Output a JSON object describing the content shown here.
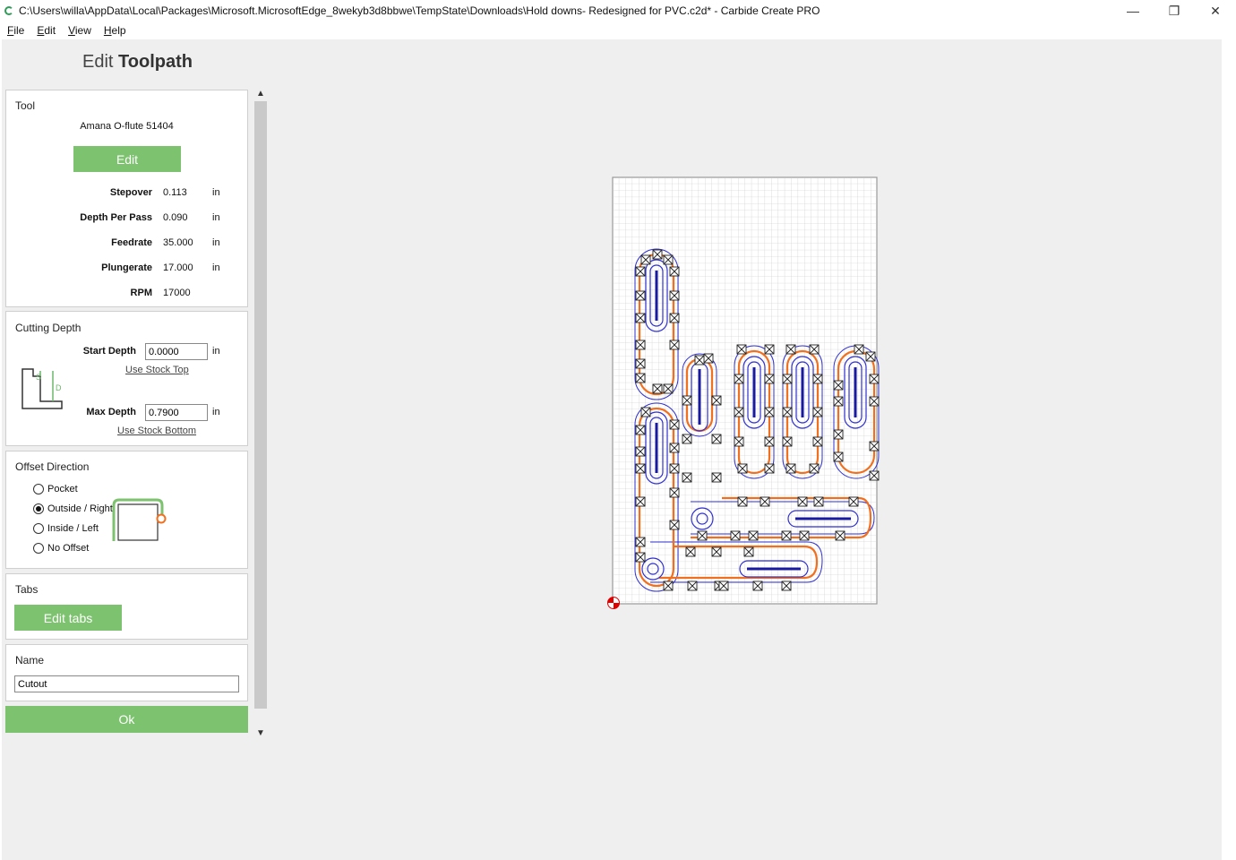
{
  "window": {
    "title": "C:\\Users\\willa\\AppData\\Local\\Packages\\Microsoft.MicrosoftEdge_8wekyb3d8bbwe\\TempState\\Downloads\\Hold downs- Redesigned for PVC.c2d* - Carbide Create PRO",
    "minimize": "—",
    "restore": "❐",
    "close": "✕"
  },
  "menu": [
    "File",
    "Edit",
    "View",
    "Help"
  ],
  "heading": {
    "light": "Edit",
    "bold": "Toolpath"
  },
  "tool": {
    "title": "Tool",
    "name": "Amana O-flute 51404",
    "edit_label": "Edit",
    "rows": [
      {
        "label": "Stepover",
        "value": "0.113",
        "unit": "in"
      },
      {
        "label": "Depth Per Pass",
        "value": "0.090",
        "unit": "in"
      },
      {
        "label": "Feedrate",
        "value": "35.000",
        "unit": "in"
      },
      {
        "label": "Plungerate",
        "value": "17.000",
        "unit": "in"
      },
      {
        "label": "RPM",
        "value": "17000",
        "unit": ""
      }
    ]
  },
  "cutting_depth": {
    "title": "Cutting Depth",
    "start_label": "Start Depth",
    "start_value": "0.0000",
    "start_unit": "in",
    "use_stock_top": "Use Stock Top",
    "max_label": "Max Depth",
    "max_value": "0.7900",
    "max_unit": "in",
    "use_stock_bottom": "Use Stock Bottom",
    "diagram_s": "S",
    "diagram_d": "D"
  },
  "offset": {
    "title": "Offset Direction",
    "options": [
      "Pocket",
      "Outside / Right",
      "Inside / Left",
      "No Offset"
    ],
    "selected": 1
  },
  "tabs": {
    "title": "Tabs",
    "button": "Edit tabs"
  },
  "name": {
    "title": "Name",
    "value": "Cutout"
  },
  "ok_label": "Ok",
  "colors": {
    "accent_green": "#7dc26f",
    "toolpath_orange": "#f07020",
    "toolpath_blue": "#3030d0",
    "origin_red": "#e00000"
  },
  "icons": {
    "scroll_up": "▲",
    "scroll_down": "▼"
  }
}
